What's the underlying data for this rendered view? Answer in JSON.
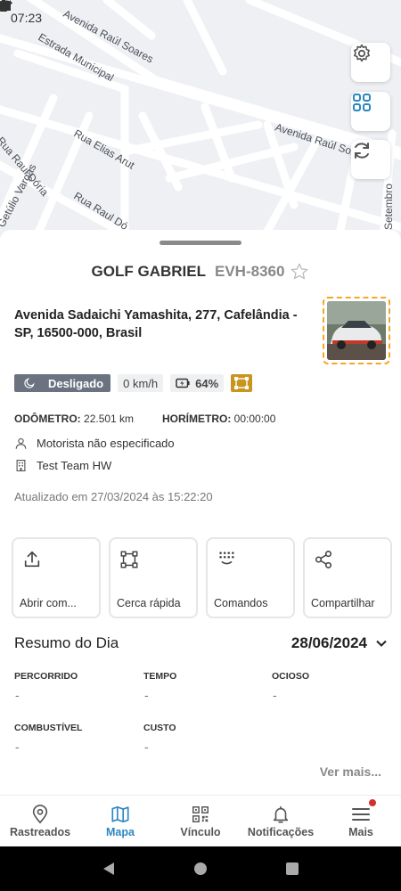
{
  "status_bar": {
    "time": "07:23"
  },
  "map": {
    "street_labels": [
      "Avenida Raúl Soares",
      "Estrada Municipal",
      "Rua Elias Arut",
      "Rua Raul Dória",
      "Rua Raul Dó",
      "Getúlio Vargas",
      "Avenida Raúl Soares",
      "Setembro"
    ]
  },
  "vehicle": {
    "name": "GOLF GABRIEL",
    "plate": "EVH-8360",
    "address": "Avenida Sadaichi Yamashita, 277, Cafelândia - SP, 16500-000, Brasil",
    "status": "Desligado",
    "speed": "0 km/h",
    "battery": "64%",
    "odometer_label": "ODÔMETRO:",
    "odometer_value": "22.501 km",
    "hourmeter_label": "HORÍMETRO:",
    "hourmeter_value": "00:00:00",
    "driver": "Motorista não especificado",
    "team": "Test Team HW",
    "updated": "Atualizado em 27/03/2024 às 15:22:20"
  },
  "actions": [
    {
      "label": "Abrir com...",
      "icon": "upload-icon"
    },
    {
      "label": "Cerca rápida",
      "icon": "fence-icon"
    },
    {
      "label": "Comandos",
      "icon": "commands-icon"
    },
    {
      "label": "Compartilhar",
      "icon": "share-icon"
    }
  ],
  "summary": {
    "title": "Resumo do Dia",
    "date": "28/06/2024",
    "stats": [
      {
        "label": "PERCORRIDO",
        "value": "-"
      },
      {
        "label": "TEMPO",
        "value": "-"
      },
      {
        "label": "OCIOSO",
        "value": "-"
      },
      {
        "label": "COMBUSTÍVEL",
        "value": "-"
      },
      {
        "label": "CUSTO",
        "value": "-"
      }
    ],
    "more": "Ver mais..."
  },
  "bottom_nav": [
    {
      "label": "Rastreados",
      "icon": "location-pin-icon"
    },
    {
      "label": "Mapa",
      "icon": "map-icon",
      "active": true
    },
    {
      "label": "Vínculo",
      "icon": "qr-code-icon"
    },
    {
      "label": "Notificações",
      "icon": "bell-icon"
    },
    {
      "label": "Mais",
      "icon": "menu-icon"
    }
  ],
  "colors": {
    "accent": "#2c87c0",
    "status_off": "#6b7280",
    "fence": "#c8951e",
    "thumb_border": "#f5a623"
  }
}
